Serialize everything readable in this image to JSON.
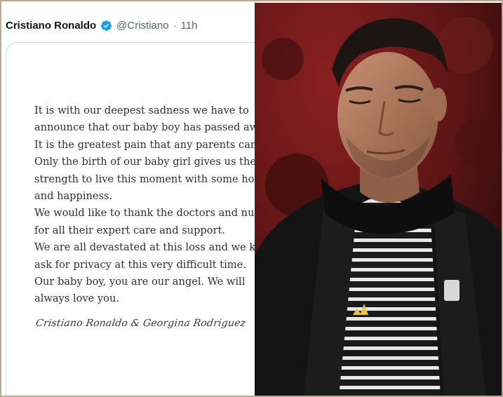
{
  "tweet": {
    "author_name": "Cristiano Ronaldo",
    "verified_icon": "verified-badge-icon",
    "handle": "@Cristiano",
    "separator": "·",
    "time": "11h",
    "statement_lines": [
      "It is with our deepest sadness we have to",
      "announce that our baby boy has passed away.",
      "It is the greatest pain that any parents can feel.",
      "Only the birth of our baby girl gives us the",
      "strength to live this moment with some hope",
      "and happiness.",
      "We would like to thank the doctors and nurses",
      "for all their expert care and support.",
      "We are all devastated at this loss and we kindly",
      "ask for privacy at this very difficult time.",
      "Our baby boy, you are our angel. We will",
      "always love you."
    ],
    "signature": "Cristiano Ronaldo & Georgina Rodriguez"
  },
  "photo": {
    "description_icon": "player-photo",
    "colors": {
      "background": "#6a1717",
      "jacket": "#141414",
      "skin": "#b07a5c",
      "hair": "#1c1512"
    }
  }
}
